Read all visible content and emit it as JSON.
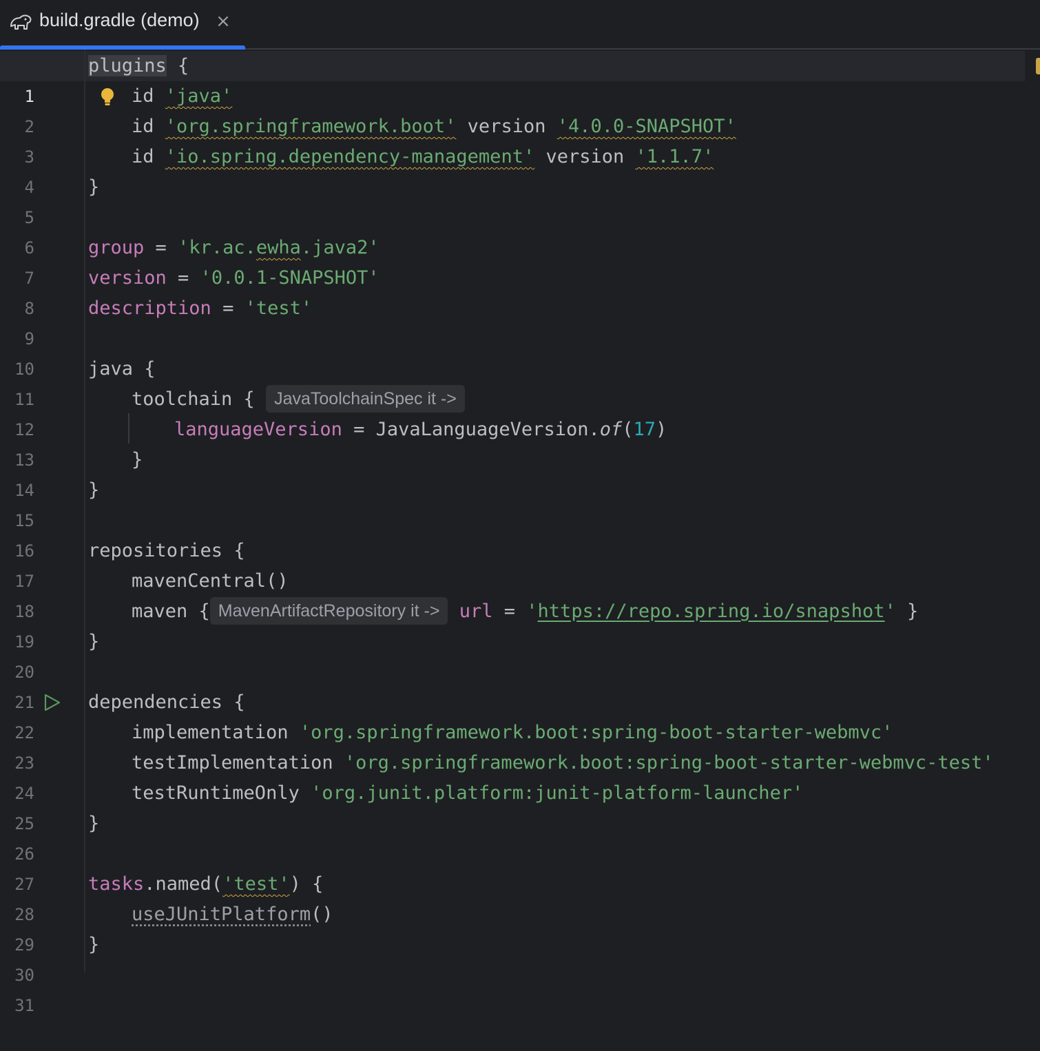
{
  "tab": {
    "title": "build.gradle (demo)",
    "close_glyph": "×",
    "icon": "gradle-elephant-icon"
  },
  "hints": {
    "toolchain": "JavaToolchainSpec it ->",
    "maven": "MavenArtifactRepository it ->"
  },
  "line_numbers": [
    "1",
    "2",
    "3",
    "4",
    "5",
    "6",
    "7",
    "8",
    "9",
    "10",
    "11",
    "12",
    "13",
    "14",
    "15",
    "16",
    "17",
    "18",
    "19",
    "20",
    "21",
    "22",
    "23",
    "24",
    "25",
    "26",
    "27",
    "28",
    "29",
    "30",
    "31"
  ],
  "code": {
    "l1": {
      "a": "plugins",
      "b": " {"
    },
    "l2": {
      "a": "id ",
      "s": "'java'"
    },
    "l3": {
      "a": "id ",
      "s1": "'org.springframework.boot'",
      "b": " version ",
      "s2": "'4.0.0-SNAPSHOT'"
    },
    "l4": {
      "a": "id ",
      "s1": "'io.spring.dependency-management'",
      "b": " version ",
      "s2": "'1.1.7'"
    },
    "l5": "}",
    "l7": {
      "p": "group",
      "eq": " = ",
      "s1": "'kr.ac.",
      "s2": "ewha",
      "s3": ".java2'"
    },
    "l8": {
      "p": "version",
      "eq": " = ",
      "s": "'0.0.1-SNAPSHOT'"
    },
    "l9": {
      "p": "description",
      "eq": " = ",
      "s": "'test'"
    },
    "l11": "java {",
    "l12": "toolchain { ",
    "l13": {
      "p": "languageVersion",
      "eq": " = JavaLanguageVersion.",
      "f": "of",
      "o": "(",
      "n": "17",
      "c": ")"
    },
    "l14": "}",
    "l15": "}",
    "l17": "repositories {",
    "l18": "mavenCentral()",
    "l19": {
      "a": "maven {",
      "p": "url",
      "eq": " = ",
      "q1": "'",
      "u": "https://repo.spring.io/snapshot",
      "q2": "'",
      "b": " }"
    },
    "l20": "}",
    "l22": "dependencies {",
    "l23": {
      "a": "implementation ",
      "s": "'org.springframework.boot:spring-boot-starter-webmvc'"
    },
    "l24": {
      "a": "testImplementation ",
      "s": "'org.springframework.boot:spring-boot-starter-webmvc-test'"
    },
    "l25": {
      "a": "testRuntimeOnly ",
      "s": "'org.junit.platform:junit-platform-launcher'"
    },
    "l26": "}",
    "l28": {
      "p": "tasks",
      "a": ".named(",
      "s": "'test'",
      "b": ") {"
    },
    "l29": {
      "d": "useJUnitPlatform",
      "b": "()"
    },
    "l30": "}"
  },
  "colors": {
    "accent": "#3574f0",
    "string": "#6aab73",
    "property": "#c77dbb",
    "number": "#2aacb8",
    "warning": "#c9a545",
    "run": "#57965c"
  }
}
